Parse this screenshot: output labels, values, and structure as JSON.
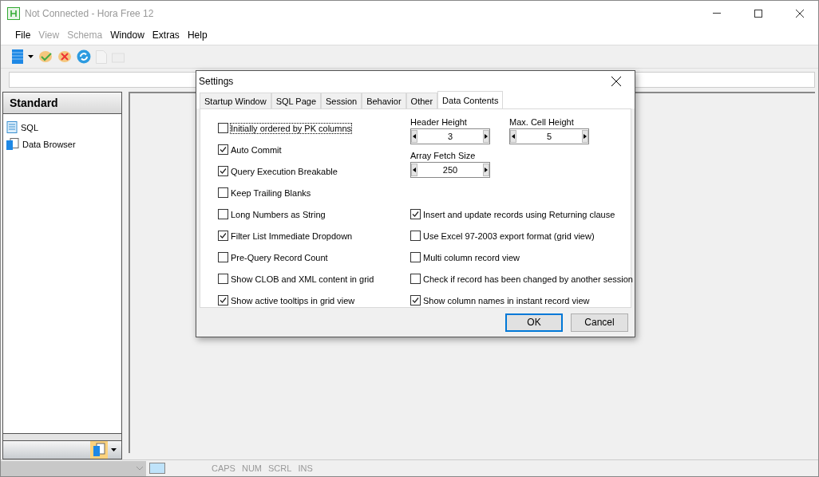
{
  "window": {
    "title": "Not Connected - Hora Free 12"
  },
  "menu": [
    {
      "label": "File",
      "disabled": false
    },
    {
      "label": "View",
      "disabled": true
    },
    {
      "label": "Schema",
      "disabled": true
    },
    {
      "label": "Window",
      "disabled": false
    },
    {
      "label": "Extras",
      "disabled": false
    },
    {
      "label": "Help",
      "disabled": false
    }
  ],
  "sidebar": {
    "title": "Standard",
    "items": [
      {
        "label": "SQL",
        "kind": "sql"
      },
      {
        "label": "Data Browser",
        "kind": "browser"
      }
    ]
  },
  "dialog": {
    "title": "Settings",
    "tabs": [
      {
        "label": "Startup Window",
        "selected": false
      },
      {
        "label": "SQL Page",
        "selected": false
      },
      {
        "label": "Session",
        "selected": false
      },
      {
        "label": "Behavior",
        "selected": false
      },
      {
        "label": "Other",
        "selected": false
      },
      {
        "label": "Data Contents",
        "selected": true
      }
    ],
    "left_options": [
      {
        "label": "Initially ordered by PK columns",
        "checked": false,
        "focused": true
      },
      {
        "label": "Auto Commit",
        "checked": true,
        "focused": false
      },
      {
        "label": "Query Execution Breakable",
        "checked": true,
        "focused": false
      },
      {
        "label": "Keep Trailing Blanks",
        "checked": false,
        "focused": false
      },
      {
        "label": "Long  Numbers as String",
        "checked": false,
        "focused": false
      },
      {
        "label": "Filter List Immediate Dropdown",
        "checked": true,
        "focused": false
      },
      {
        "label": "Pre-Query Record Count",
        "checked": false,
        "focused": false
      },
      {
        "label": "Show CLOB and XML content in grid",
        "checked": false,
        "focused": false
      },
      {
        "label": "Show active tooltips in grid view",
        "checked": true,
        "focused": false
      }
    ],
    "spinners": [
      {
        "label": "Header Height",
        "value": "3"
      },
      {
        "label": "Max. Cell Height",
        "value": "5"
      },
      {
        "label": "Array Fetch Size",
        "value": "250"
      }
    ],
    "right_options": [
      {
        "label": "Insert and update records using Returning clause",
        "checked": true
      },
      {
        "label": "Use Excel 97-2003 export format (grid view)",
        "checked": false
      },
      {
        "label": "Multi column record view",
        "checked": false
      },
      {
        "label": "Check if record has been changed by another session",
        "checked": false
      },
      {
        "label": "Show column names in  instant record view",
        "checked": true
      }
    ],
    "buttons": [
      {
        "label": "OK",
        "default": true
      },
      {
        "label": "Cancel",
        "default": false
      }
    ]
  },
  "status_bar": [
    "CAPS",
    "NUM",
    "SCRL",
    "INS"
  ]
}
